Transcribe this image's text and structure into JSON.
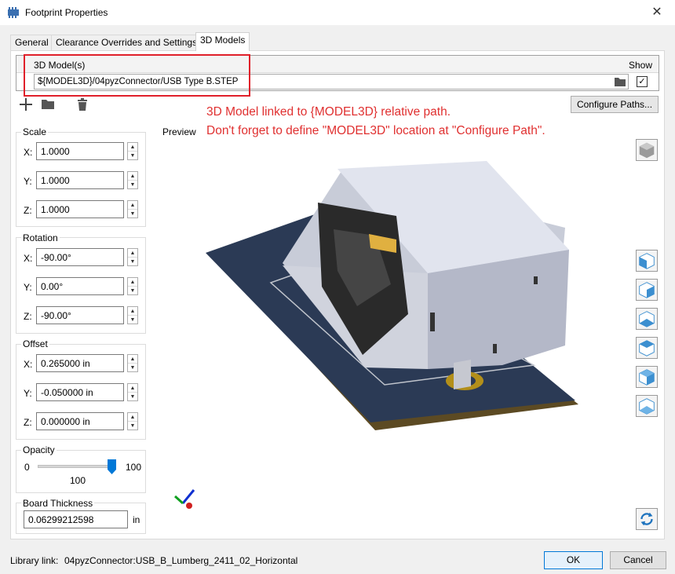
{
  "window": {
    "title": "Footprint Properties",
    "close": "✕"
  },
  "tabs": [
    {
      "label": "General"
    },
    {
      "label": "Clearance Overrides and Settings"
    },
    {
      "label": "3D Models"
    }
  ],
  "models_table": {
    "header_model": "3D Model(s)",
    "header_show": "Show",
    "rows": [
      {
        "path": "${MODEL3D}/04pyzConnector/USB Type B.STEP",
        "show": true
      }
    ]
  },
  "toolbar": {
    "add_icon": "plus-icon",
    "browse_icon": "folder-icon",
    "delete_icon": "trash-icon",
    "configure_paths": "Configure Paths..."
  },
  "note_lines": [
    "3D Model linked to {MODEL3D} relative path.",
    "Don't forget to define \"MODEL3D\" location at \"Configure Path\"."
  ],
  "scale": {
    "label": "Scale",
    "x_label": "X:",
    "y_label": "Y:",
    "z_label": "Z:",
    "x": "1.0000",
    "y": "1.0000",
    "z": "1.0000"
  },
  "rotation": {
    "label": "Rotation",
    "x_label": "X:",
    "y_label": "Y:",
    "z_label": "Z:",
    "x": "-90.00°",
    "y": "0.00°",
    "z": "-90.00°"
  },
  "offset": {
    "label": "Offset",
    "x_label": "X:",
    "y_label": "Y:",
    "z_label": "Z:",
    "x": "0.265000 in",
    "y": "-0.050000 in",
    "z": "0.000000 in"
  },
  "opacity": {
    "label": "Opacity",
    "min": "0",
    "max": "100",
    "value": "100",
    "level": 1.0
  },
  "board_thickness": {
    "label": "Board Thickness",
    "value": "0.06299212598",
    "unit": "in"
  },
  "preview": {
    "label": "Preview"
  },
  "view_buttons": [
    "iso-view-icon",
    "front-view-icon",
    "back-view-icon",
    "left-view-icon",
    "right-view-icon",
    "top-view-icon",
    "bottom-view-icon",
    "reload-icon"
  ],
  "footer": {
    "library_link_label": "Library link:",
    "library_link": "04pyzConnector:USB_B_Lumberg_2411_02_Horizontal",
    "ok": "OK",
    "cancel": "Cancel"
  },
  "colors": {
    "accent": "#0078d7",
    "annotation": "#e03030",
    "highlight_box": "#e0202a",
    "pcb": "#2b3a55"
  }
}
